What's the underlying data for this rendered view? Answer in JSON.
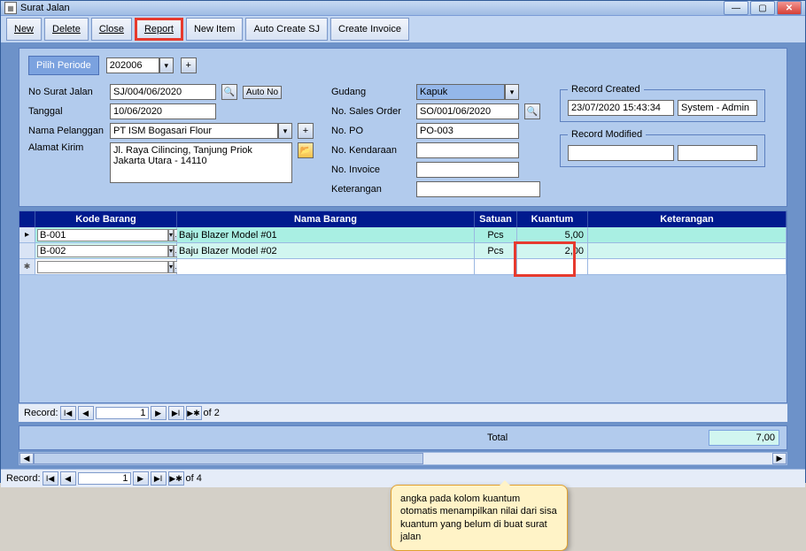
{
  "window": {
    "title": "Surat Jalan"
  },
  "toolbar": {
    "new": "New",
    "delete": "Delete",
    "close": "Close",
    "report": "Report",
    "new_item": "New Item",
    "auto_create": "Auto Create SJ",
    "create_invoice": "Create Invoice"
  },
  "periode": {
    "label": "Pilih Periode",
    "value": "202006"
  },
  "left": {
    "no_sj_label": "No Surat Jalan",
    "no_sj": "SJ/004/06/2020",
    "auto_no": "Auto No",
    "tanggal_label": "Tanggal",
    "tanggal": "10/06/2020",
    "nama_label": "Nama Pelanggan",
    "nama": "PT ISM Bogasari Flour",
    "alamat_label": "Alamat Kirim",
    "alamat": "Jl. Raya Cilincing, Tanjung Priok\nJakarta Utara - 14110"
  },
  "mid": {
    "gudang_label": "Gudang",
    "gudang": "Kapuk",
    "so_label": "No. Sales Order",
    "so": "SO/001/06/2020",
    "po_label": "No. PO",
    "po": "PO-003",
    "kendaraan_label": "No. Kendaraan",
    "kendaraan": "",
    "inv_label": "No. Invoice",
    "inv": "",
    "ket_label": "Keterangan",
    "ket": ""
  },
  "right": {
    "created_legend": "Record Created",
    "created_dt": "23/07/2020 15:43:34",
    "created_by": "System - Admin",
    "modified_legend": "Record Modified",
    "modified_dt": "",
    "modified_by": ""
  },
  "grid": {
    "headers": {
      "kode": "Kode Barang",
      "nama": "Nama Barang",
      "satuan": "Satuan",
      "kuantum": "Kuantum",
      "ket": "Keterangan"
    },
    "rows": [
      {
        "kode": "B-001",
        "nama": "Baju Blazer Model #01",
        "satuan": "Pcs",
        "kuantum": "5,00",
        "ket": ""
      },
      {
        "kode": "B-002",
        "nama": "Baju Blazer Model #02",
        "satuan": "Pcs",
        "kuantum": "2,00",
        "ket": ""
      }
    ]
  },
  "callout": "angka pada kolom kuantum otomatis menampilkan nilai dari sisa kuantum yang belum di buat surat jalan",
  "nav_inner": {
    "label": "Record:",
    "pos": "1",
    "of": "of  2"
  },
  "total": {
    "label": "Total",
    "value": "7,00"
  },
  "nav_outer": {
    "label": "Record:",
    "pos": "1",
    "of": "of  4"
  }
}
